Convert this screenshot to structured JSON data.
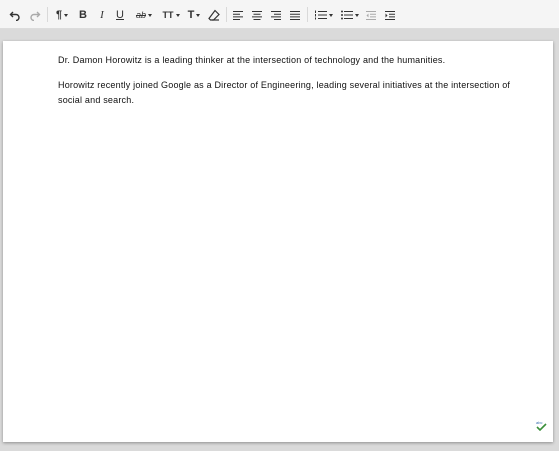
{
  "toolbar": {
    "buttons": [
      {
        "name": "undo-button",
        "icon": "undo-icon"
      },
      {
        "name": "redo-button",
        "icon": "redo-icon"
      },
      {
        "name": "paragraph-format-button",
        "icon": "pilcrow-icon"
      },
      {
        "name": "bold-button",
        "icon": "bold-icon"
      },
      {
        "name": "italic-button",
        "icon": "italic-icon"
      },
      {
        "name": "underline-button",
        "icon": "underline-icon"
      },
      {
        "name": "strikethrough-button",
        "icon": "strikethrough-icon"
      },
      {
        "name": "font-size-button",
        "icon": "font-size-icon"
      },
      {
        "name": "text-color-button",
        "icon": "text-color-icon"
      },
      {
        "name": "clear-formatting-button",
        "icon": "eraser-icon"
      },
      {
        "name": "align-left-button",
        "icon": "align-left-icon"
      },
      {
        "name": "align-center-button",
        "icon": "align-center-icon"
      },
      {
        "name": "align-right-button",
        "icon": "align-right-icon"
      },
      {
        "name": "justify-button",
        "icon": "justify-icon"
      },
      {
        "name": "numbered-list-button",
        "icon": "numbered-list-icon"
      },
      {
        "name": "bulleted-list-button",
        "icon": "bulleted-list-icon"
      },
      {
        "name": "outdent-button",
        "icon": "outdent-icon"
      },
      {
        "name": "indent-button",
        "icon": "indent-icon"
      }
    ],
    "labels": {
      "bold": "B",
      "italic": "I",
      "underline": "U",
      "strikethrough": "ab",
      "font_size": "TT",
      "text_color": "T"
    }
  },
  "document": {
    "paragraphs": [
      "Dr. Damon Horowitz is a leading thinker at the intersection of technology and the humanities.",
      "Horowitz recently joined Google as a Director of Engineering, leading several initiatives at the intersection of social and search."
    ]
  },
  "status": {
    "spellcheck_icon": "spellcheck-icon"
  },
  "colors": {
    "toolbar_bg": "#f5f5f5",
    "workspace_bg": "#dadada",
    "page_bg": "#ffffff",
    "spellcheck": "#3a8f3a"
  }
}
